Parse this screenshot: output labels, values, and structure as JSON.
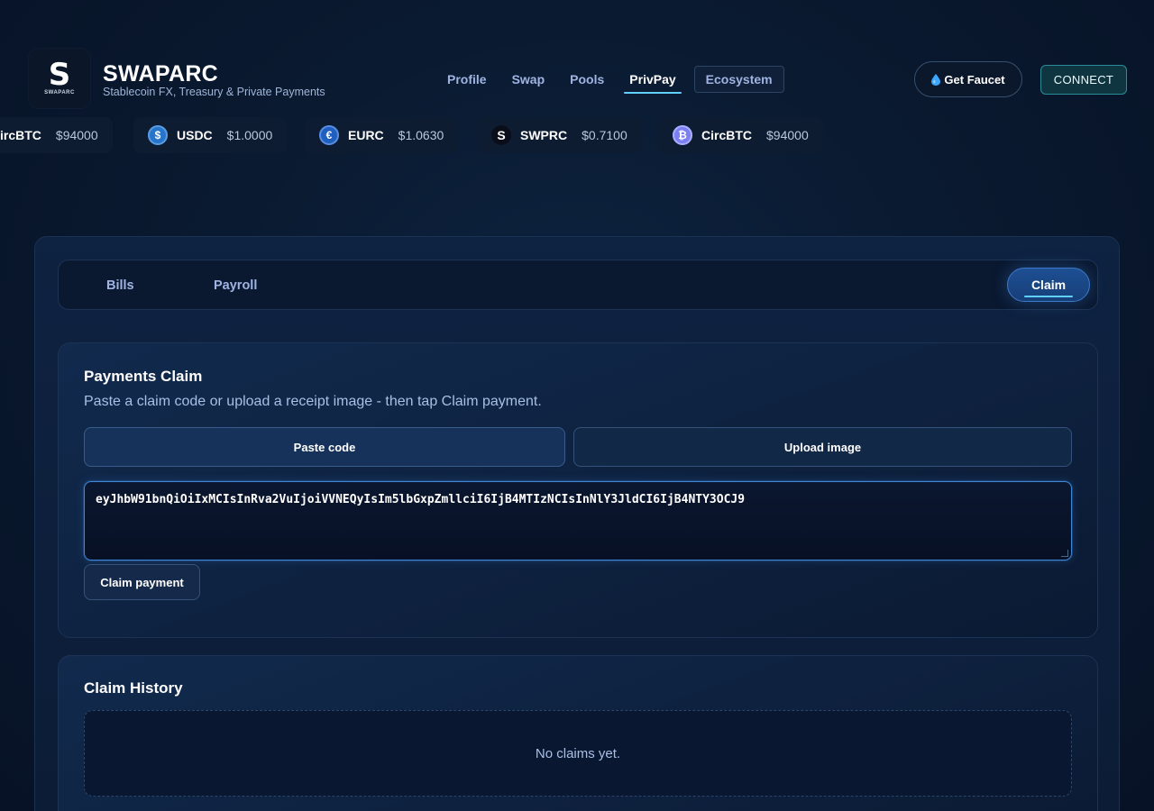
{
  "brand": {
    "logo_letter": "S",
    "logo_text": "SWAPARC",
    "title": "SWAPARC",
    "subtitle": "Stablecoin FX, Treasury & Private Payments"
  },
  "nav": {
    "items": [
      {
        "label": "Profile"
      },
      {
        "label": "Swap"
      },
      {
        "label": "Pools"
      },
      {
        "label": "PrivPay",
        "active": true
      },
      {
        "label": "Ecosystem"
      }
    ]
  },
  "header": {
    "faucet_label": "Get Faucet",
    "connect_label": "CONNECT"
  },
  "ticker": [
    {
      "symbol": "ircBTC",
      "price": "$94000",
      "icon": "bitcoin-coin-icon"
    },
    {
      "symbol": "USDC",
      "price": "$1.0000",
      "icon": "usdc-coin-icon"
    },
    {
      "symbol": "EURC",
      "price": "$1.0630",
      "icon": "eurc-coin-icon"
    },
    {
      "symbol": "SWPRC",
      "price": "$0.7100",
      "icon": "swprc-coin-icon"
    },
    {
      "symbol": "CircBTC",
      "price": "$94000",
      "icon": "bitcoin-coin-icon"
    }
  ],
  "tabs": {
    "bills": "Bills",
    "payroll": "Payroll",
    "claim": "Claim",
    "active": "Claim"
  },
  "claim_card": {
    "title": "Payments Claim",
    "description": "Paste a claim code or upload a receipt image - then tap Claim payment.",
    "paste_label": "Paste code",
    "upload_label": "Upload image",
    "code_value": "eyJhbW91bnQiOiIxMCIsInRva2VuIjoiVVNEQyIsIm5lbGxpZmllciI6IjB4MTIzNCIsInNlY3JldCI6IjB4NTY3OCJ9",
    "claim_button": "Claim payment"
  },
  "history_card": {
    "title": "Claim History",
    "empty_text": "No claims yet."
  },
  "colors": {
    "background": "#0a1a30",
    "accent": "#5fd0ff",
    "connect_border": "#2a8c98",
    "active_tab": "#1d4f93"
  }
}
